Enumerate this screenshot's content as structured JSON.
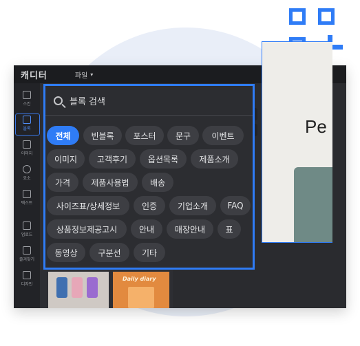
{
  "brand": {
    "logo": "캐디터",
    "accent": "#2f7cf6"
  },
  "menu": {
    "file_label": "파일"
  },
  "sidebar": {
    "items": [
      {
        "label": "스킨",
        "icon": "layout-icon"
      },
      {
        "label": "블록",
        "icon": "block-icon",
        "active": true
      },
      {
        "label": "이미지",
        "icon": "image-icon"
      },
      {
        "label": "요소",
        "icon": "shapes-icon"
      },
      {
        "label": "텍스트",
        "icon": "text-icon"
      },
      {
        "label": "업로드",
        "icon": "upload-icon"
      },
      {
        "label": "즐겨찾기",
        "icon": "bookmark-icon"
      },
      {
        "label": "디자인",
        "icon": "my-design-icon"
      }
    ]
  },
  "block_search": {
    "placeholder": "블록 검색",
    "categories": [
      "전체",
      "빈블록",
      "포스터",
      "문구",
      "이벤트",
      "이미지",
      "고객후기",
      "옵션목록",
      "제품소개",
      "가격",
      "제품사용법",
      "배송",
      "사이즈표/상세정보",
      "인증",
      "기업소개",
      "FAQ",
      "상품정보제공고시",
      "안내",
      "매장안내",
      "표",
      "동영상",
      "구분선",
      "기타"
    ],
    "selected": "전체"
  },
  "thumbnails": [
    {
      "kind": "phone-cases-photo"
    },
    {
      "kind": "diary-photo",
      "caption": "Daily diary"
    }
  ],
  "canvas": {
    "preview_text": "Pe"
  }
}
